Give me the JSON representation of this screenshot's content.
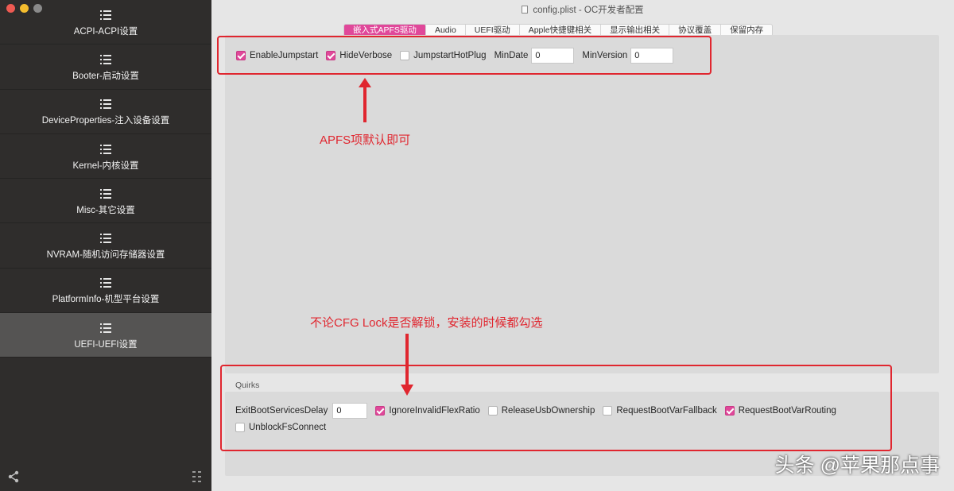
{
  "window": {
    "title": "config.plist - OC开发者配置"
  },
  "sidebar": {
    "items": [
      {
        "label": "ACPI-ACPI设置",
        "active": false
      },
      {
        "label": "Booter-启动设置",
        "active": false
      },
      {
        "label": "DeviceProperties-注入设备设置",
        "active": false
      },
      {
        "label": "Kernel-内核设置",
        "active": false
      },
      {
        "label": "Misc-其它设置",
        "active": false
      },
      {
        "label": "NVRAM-随机访问存储器设置",
        "active": false
      },
      {
        "label": "PlatformInfo-机型平台设置",
        "active": false
      },
      {
        "label": "UEFI-UEFI设置",
        "active": true
      }
    ]
  },
  "tabs": [
    {
      "label": "嵌入式APFS驱动",
      "active": true
    },
    {
      "label": "Audio",
      "active": false
    },
    {
      "label": "UEFI驱动",
      "active": false
    },
    {
      "label": "Apple快捷键相关",
      "active": false
    },
    {
      "label": "显示输出相关",
      "active": false
    },
    {
      "label": "协议覆盖",
      "active": false
    },
    {
      "label": "保留内存",
      "active": false
    }
  ],
  "apfs": {
    "enable_jumpstart": {
      "label": "EnableJumpstart",
      "checked": true
    },
    "hide_verbose": {
      "label": "HideVerbose",
      "checked": true
    },
    "jumpstart_hotplug": {
      "label": "JumpstartHotPlug",
      "checked": false
    },
    "min_date": {
      "label": "MinDate",
      "value": "0"
    },
    "min_version": {
      "label": "MinVersion",
      "value": "0"
    }
  },
  "quirks": {
    "title": "Quirks",
    "exit_boot_services_delay": {
      "label": "ExitBootServicesDelay",
      "value": "0"
    },
    "items": [
      {
        "label": "IgnoreInvalidFlexRatio",
        "checked": true
      },
      {
        "label": "ReleaseUsbOwnership",
        "checked": false
      },
      {
        "label": "RequestBootVarFallback",
        "checked": false
      },
      {
        "label": "RequestBootVarRouting",
        "checked": true
      },
      {
        "label": "UnblockFsConnect",
        "checked": false
      }
    ]
  },
  "annotations": {
    "apfs_note": "APFS项默认即可",
    "quirks_note": "不论CFG Lock是否解锁，安装的时候都勾选"
  },
  "watermark": "头条 @苹果那点事",
  "colors": {
    "accent": "#e0489a",
    "annotation": "#e0262f",
    "sidebar_bg": "#2f2d2c"
  }
}
